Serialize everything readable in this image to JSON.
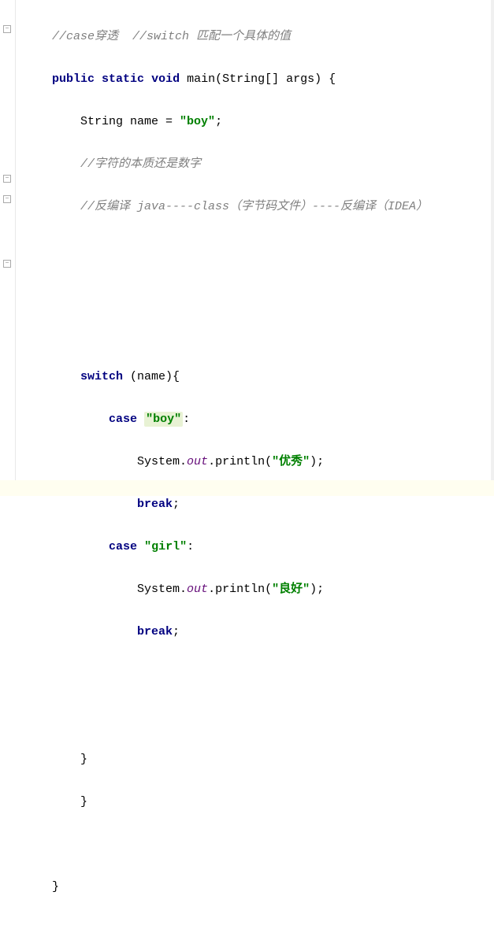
{
  "code": {
    "l1_comment1": "//case穿透",
    "l1_comment2": "//switch 匹配一个具体的值",
    "l2_public": "public",
    "l2_static": "static",
    "l2_void": "void",
    "l2_main": "main(String[] args) {",
    "l3_string": "String name = ",
    "l3_val": "\"boy\"",
    "l3_semi": ";",
    "l4_comment": "//字符的本质还是数字",
    "l5_comment": "//反编译 java----class（字节码文件）----反编译（IDEA）",
    "l9_switch": "switch",
    "l9_rest": " (name){",
    "l10_case": "case",
    "l10_val": "\"boy\"",
    "l10_colon": ":",
    "l11_sys": "System.",
    "l11_out": "out",
    "l11_print": ".println(",
    "l11_str": "\"优秀\"",
    "l11_end": ");",
    "l12_break": "break",
    "l12_semi": ";",
    "l13_case": "case",
    "l13_val": "\"girl\"",
    "l13_colon": ":",
    "l14_sys": "System.",
    "l14_out": "out",
    "l14_print": ".println(",
    "l14_str": "\"良好\"",
    "l14_end": ");",
    "l15_break": "break",
    "l15_semi": ";",
    "l18_brace": "}",
    "l19_brace": "}",
    "l21_brace": "}"
  }
}
